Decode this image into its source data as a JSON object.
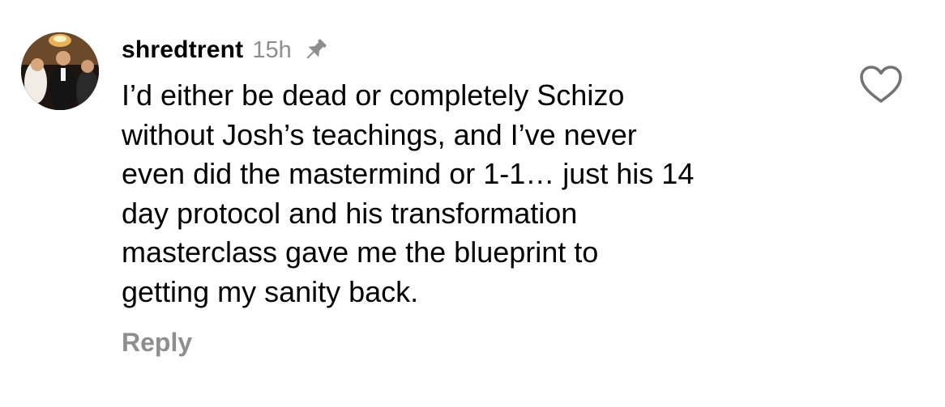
{
  "comment": {
    "username": "shredtrent",
    "timestamp": "15h",
    "pin_icon": "pin-icon",
    "text": "I’d either be dead or completely Schizo\nwithout Josh’s teachings, and I’ve never\neven did the mastermind or 1-1… just his 14\nday protocol and his transformation\nmasterclass gave me the blueprint to\ngetting my sanity back.",
    "reply_label": "Reply",
    "like_icon": "heart-outline-icon"
  },
  "colors": {
    "text_primary": "#000000",
    "text_secondary": "#8e8e8e",
    "background": "#ffffff"
  }
}
